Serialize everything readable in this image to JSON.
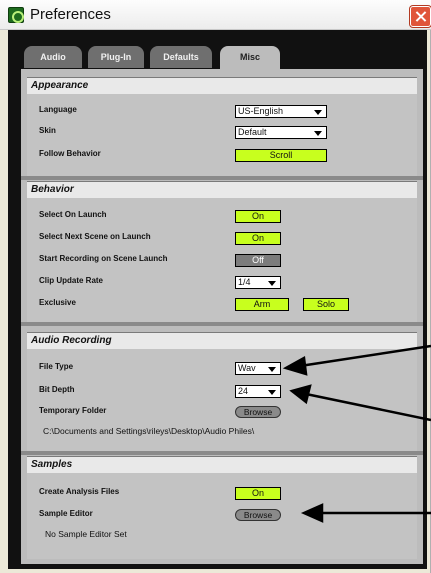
{
  "window": {
    "title": "Preferences"
  },
  "tabs": [
    "Audio",
    "Plug-In",
    "Defaults",
    "Misc"
  ],
  "appearance": {
    "heading": "Appearance",
    "language_label": "Language",
    "language_value": "US-English",
    "skin_label": "Skin",
    "skin_value": "Default",
    "follow_label": "Follow Behavior",
    "follow_value": "Scroll"
  },
  "behavior": {
    "heading": "Behavior",
    "select_on_launch_label": "Select On Launch",
    "select_on_launch_value": "On",
    "select_next_label": "Select Next Scene on Launch",
    "select_next_value": "On",
    "start_recording_label": "Start Recording on Scene Launch",
    "start_recording_value": "Off",
    "clip_rate_label": "Clip Update Rate",
    "clip_rate_value": "1/4",
    "exclusive_label": "Exclusive",
    "exclusive_arm": "Arm",
    "exclusive_solo": "Solo"
  },
  "audio_recording": {
    "heading": "Audio Recording",
    "file_type_label": "File Type",
    "file_type_value": "Wav",
    "bit_depth_label": "Bit Depth",
    "bit_depth_value": "24",
    "temp_folder_label": "Temporary Folder",
    "browse_label": "Browse",
    "temp_folder_path": "C:\\Documents and Settings\\rileys\\Desktop\\Audio Philes\\"
  },
  "samples": {
    "heading": "Samples",
    "create_analysis_label": "Create Analysis Files",
    "create_analysis_value": "On",
    "sample_editor_label": "Sample Editor",
    "browse_label": "Browse",
    "no_editor_text": "No Sample Editor Set"
  },
  "colors": {
    "toggle_on": "#c8ff1e",
    "panel_bg": "#bcbcbc",
    "frame_bg": "#111111"
  }
}
